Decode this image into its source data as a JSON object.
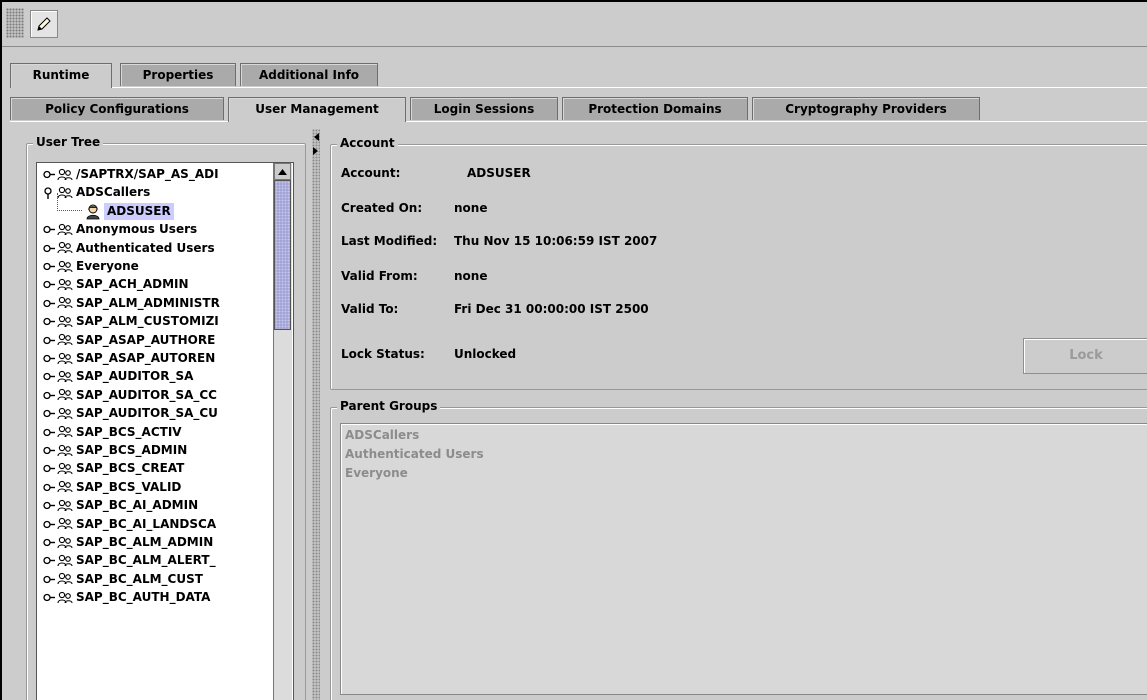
{
  "tabs_top": [
    {
      "label": "Runtime",
      "active": true
    },
    {
      "label": "Properties",
      "active": false
    },
    {
      "label": "Additional Info",
      "active": false
    }
  ],
  "tabs_sub": [
    {
      "label": "Policy Configurations",
      "active": false
    },
    {
      "label": "User Management",
      "active": true
    },
    {
      "label": "Login Sessions",
      "active": false
    },
    {
      "label": "Protection Domains",
      "active": false
    },
    {
      "label": "Cryptography Providers",
      "active": false
    }
  ],
  "user_tree": {
    "title": "User Tree",
    "items": [
      {
        "label": "/SAPTRX/SAP_AS_ADI",
        "expanded": false
      },
      {
        "label": "ADSCallers",
        "expanded": true
      },
      {
        "label": "ADSUSER",
        "child": true,
        "selected": true
      },
      {
        "label": "Anonymous Users",
        "expanded": false
      },
      {
        "label": "Authenticated Users",
        "expanded": false
      },
      {
        "label": "Everyone",
        "expanded": false
      },
      {
        "label": "SAP_ACH_ADMIN",
        "expanded": false
      },
      {
        "label": "SAP_ALM_ADMINISTR",
        "expanded": false
      },
      {
        "label": "SAP_ALM_CUSTOMIZI",
        "expanded": false
      },
      {
        "label": "SAP_ASAP_AUTHORE",
        "expanded": false
      },
      {
        "label": "SAP_ASAP_AUTOREN",
        "expanded": false
      },
      {
        "label": "SAP_AUDITOR_SA",
        "expanded": false
      },
      {
        "label": "SAP_AUDITOR_SA_CC",
        "expanded": false
      },
      {
        "label": "SAP_AUDITOR_SA_CU",
        "expanded": false
      },
      {
        "label": "SAP_BCS_ACTIV",
        "expanded": false
      },
      {
        "label": "SAP_BCS_ADMIN",
        "expanded": false
      },
      {
        "label": "SAP_BCS_CREAT",
        "expanded": false
      },
      {
        "label": "SAP_BCS_VALID",
        "expanded": false
      },
      {
        "label": "SAP_BC_AI_ADMIN",
        "expanded": false
      },
      {
        "label": "SAP_BC_AI_LANDSCA",
        "expanded": false
      },
      {
        "label": "SAP_BC_ALM_ADMIN",
        "expanded": false
      },
      {
        "label": "SAP_BC_ALM_ALERT_",
        "expanded": false
      },
      {
        "label": "SAP_BC_ALM_CUST",
        "expanded": false
      },
      {
        "label": "SAP_BC_AUTH_DATA",
        "expanded": false
      }
    ]
  },
  "account": {
    "title": "Account",
    "fields": [
      {
        "label": "Account:",
        "value": "ADSUSER"
      },
      {
        "label": "Created On:",
        "value": "none"
      },
      {
        "label": "Last Modified:",
        "value": "Thu Nov 15 10:06:59 IST 2007"
      },
      {
        "label": "Valid From:",
        "value": "none"
      },
      {
        "label": "Valid To:",
        "value": "Fri Dec 31 00:00:00 IST 2500"
      },
      {
        "label": "Lock Status:",
        "value": "Unlocked"
      }
    ],
    "lock_button": "Lock"
  },
  "parent_groups": {
    "title": "Parent Groups",
    "items": [
      "ADSCallers",
      "Authenticated Users",
      "Everyone"
    ]
  }
}
